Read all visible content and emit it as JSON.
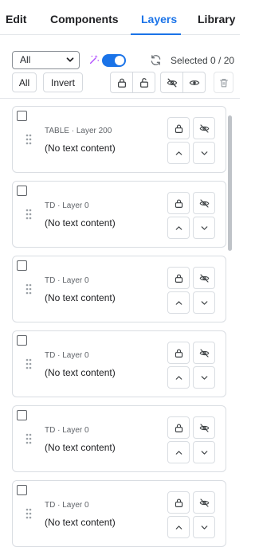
{
  "tabs": [
    {
      "label": "Edit",
      "active": false
    },
    {
      "label": "Components",
      "active": false
    },
    {
      "label": "Layers",
      "active": true
    },
    {
      "label": "Library",
      "active": false
    }
  ],
  "toolbar": {
    "filter_value": "All",
    "magic_toggle_on": true,
    "selected_label": "Selected 0 / 20",
    "all_button": "All",
    "invert_button": "Invert"
  },
  "layers": [
    {
      "meta": "TABLE · Layer 200",
      "content": "(No text content)",
      "checked": false
    },
    {
      "meta": "TD · Layer 0",
      "content": "(No text content)",
      "checked": false
    },
    {
      "meta": "TD · Layer 0",
      "content": "(No text content)",
      "checked": false
    },
    {
      "meta": "TD · Layer 0",
      "content": "(No text content)",
      "checked": false
    },
    {
      "meta": "TD · Layer 0",
      "content": "(No text content)",
      "checked": false
    },
    {
      "meta": "TD · Layer 0",
      "content": "(No text content)",
      "checked": false
    }
  ],
  "colors": {
    "accent": "#1a73e8",
    "wand": "#b04cff",
    "border": "#d9dde2"
  }
}
